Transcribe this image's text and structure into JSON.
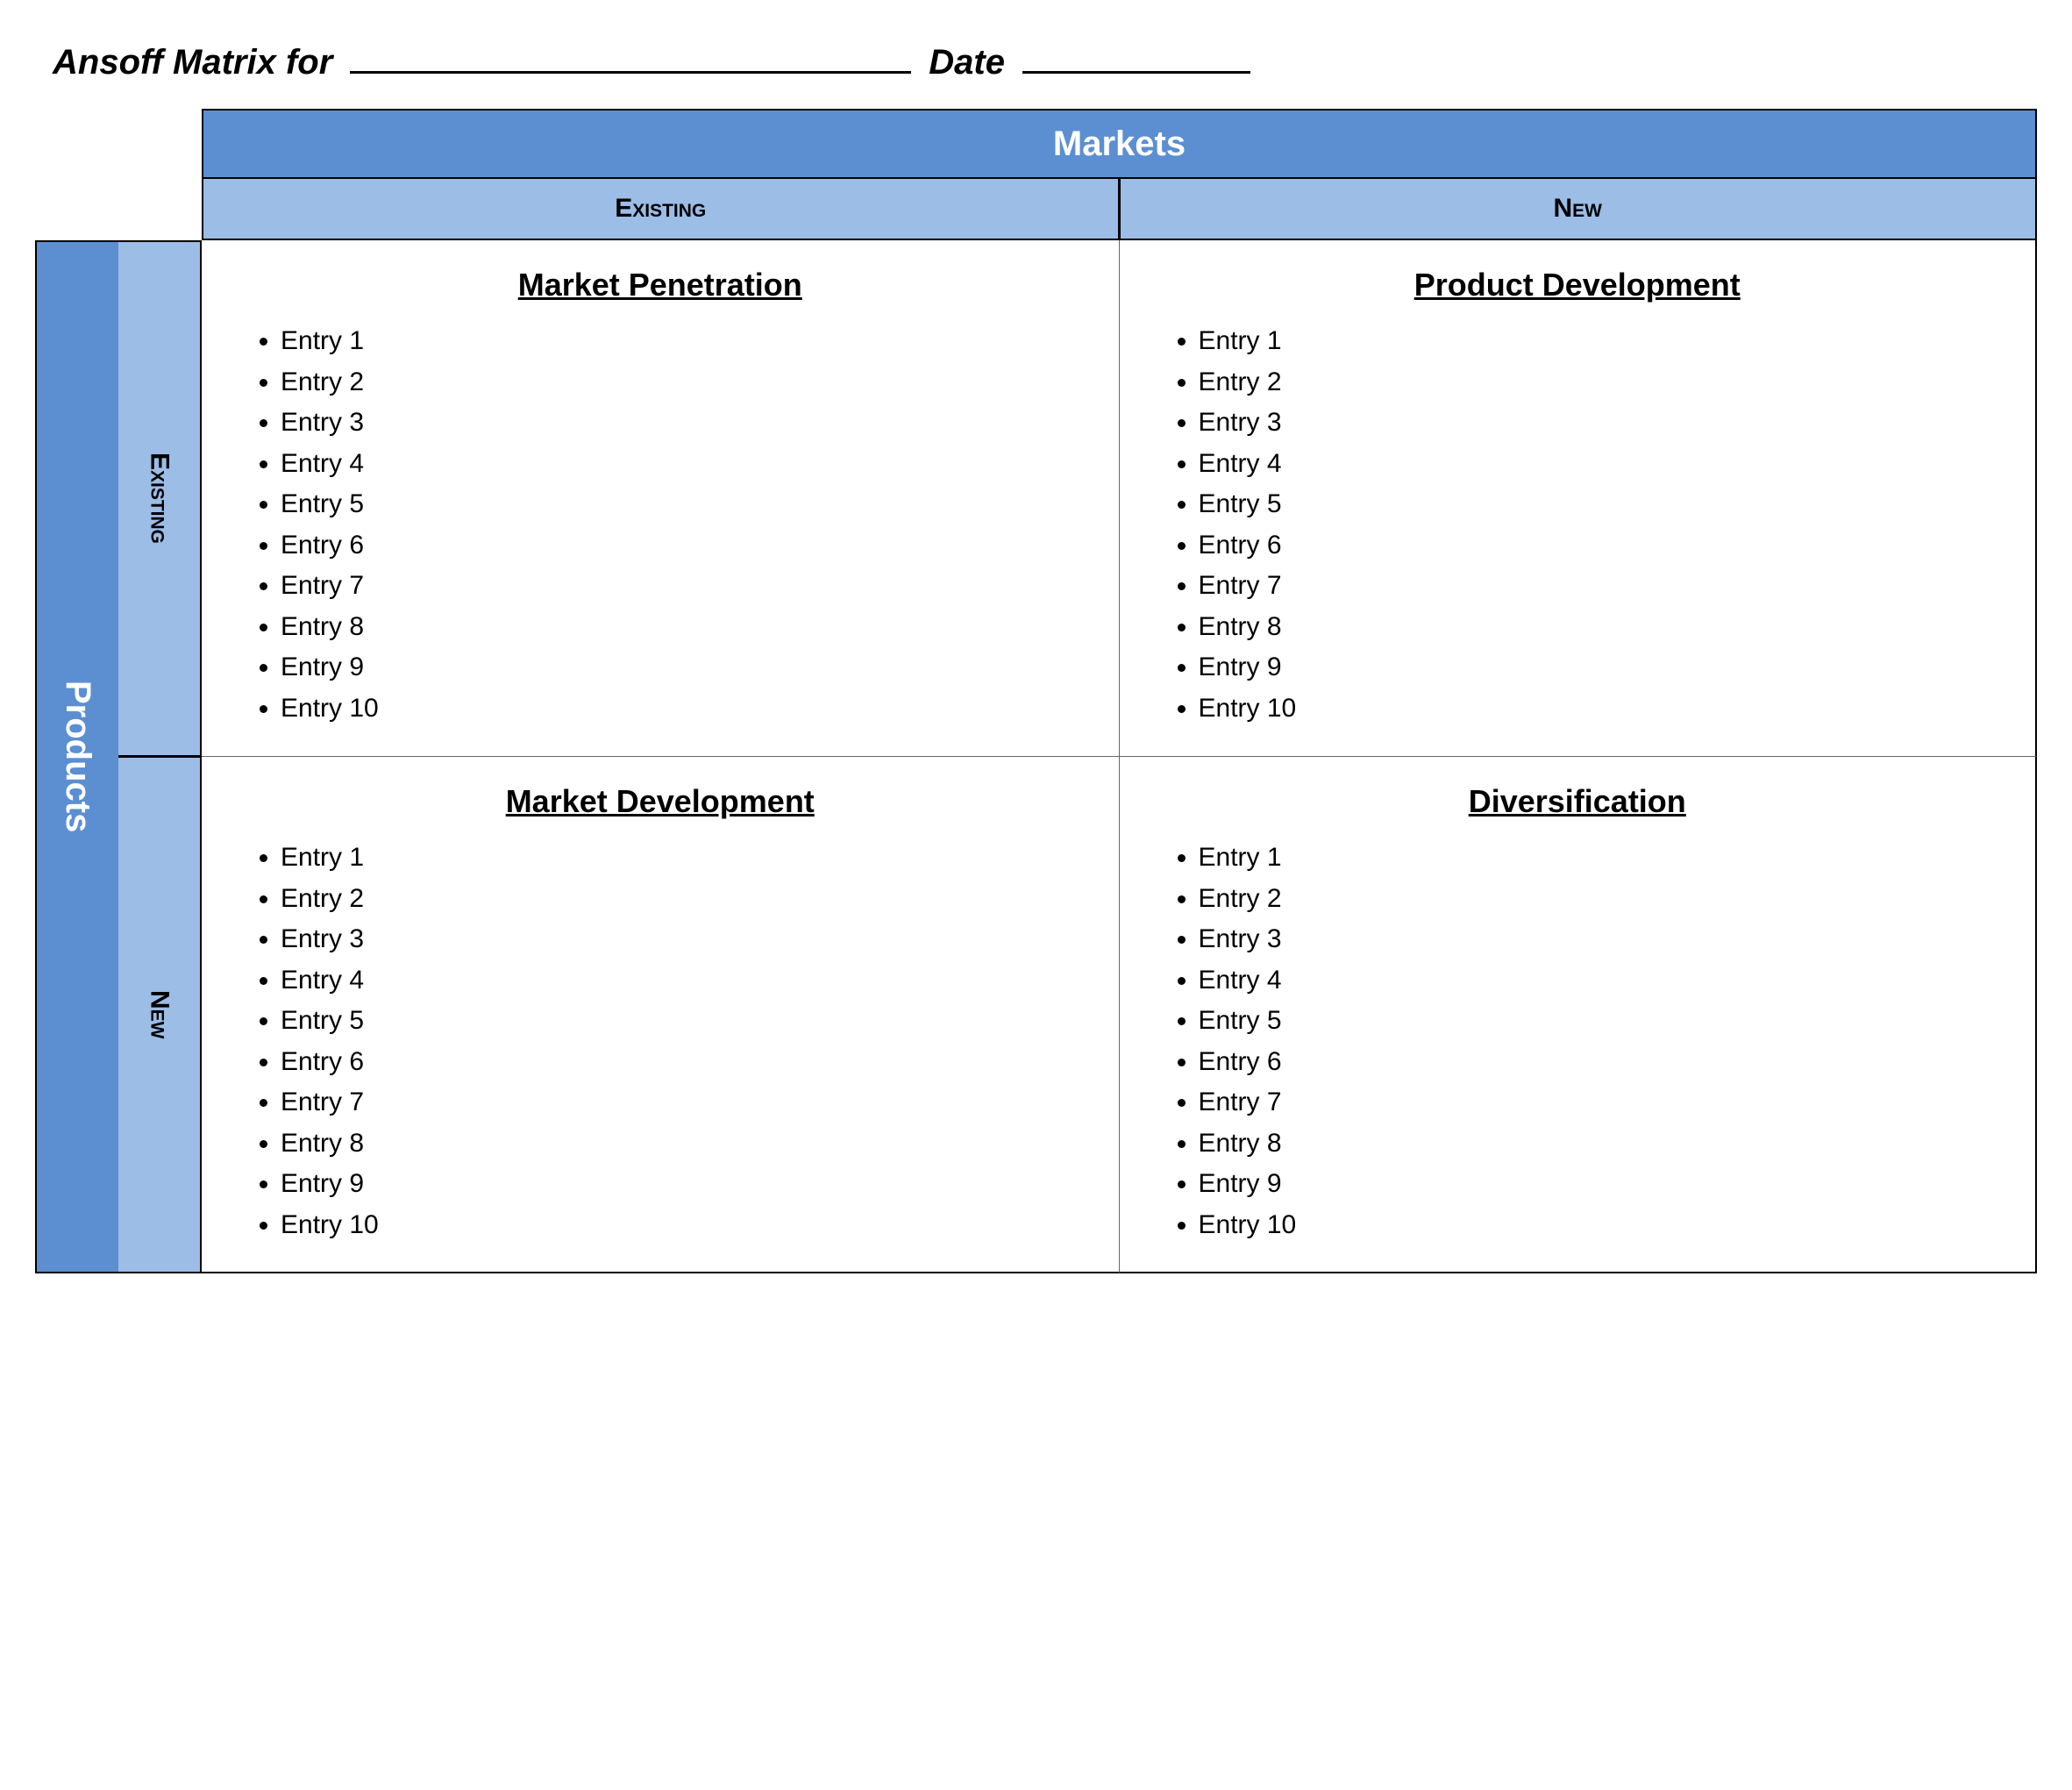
{
  "header": {
    "title_prefix": "Ansoff Matrix for",
    "date_label": "Date"
  },
  "axes": {
    "markets_label": "Markets",
    "products_label": "Products",
    "existing": "Existing",
    "new": "New"
  },
  "quadrants": {
    "market_penetration": {
      "title": "Market Penetration",
      "entries": [
        "Entry 1",
        "Entry 2",
        "Entry 3",
        "Entry 4",
        "Entry 5",
        "Entry 6",
        "Entry 7",
        "Entry 8",
        "Entry 9",
        "Entry 10"
      ]
    },
    "product_development": {
      "title": "Product Development",
      "entries": [
        "Entry 1",
        "Entry 2",
        "Entry 3",
        "Entry 4",
        "Entry 5",
        "Entry 6",
        "Entry 7",
        "Entry 8",
        "Entry 9",
        "Entry 10"
      ]
    },
    "market_development": {
      "title": "Market Development",
      "entries": [
        "Entry 1",
        "Entry 2",
        "Entry 3",
        "Entry 4",
        "Entry 5",
        "Entry 6",
        "Entry 7",
        "Entry 8",
        "Entry 9",
        "Entry 10"
      ]
    },
    "diversification": {
      "title": "Diversification",
      "entries": [
        "Entry 1",
        "Entry 2",
        "Entry 3",
        "Entry 4",
        "Entry 5",
        "Entry 6",
        "Entry 7",
        "Entry 8",
        "Entry 9",
        "Entry 10"
      ]
    }
  }
}
